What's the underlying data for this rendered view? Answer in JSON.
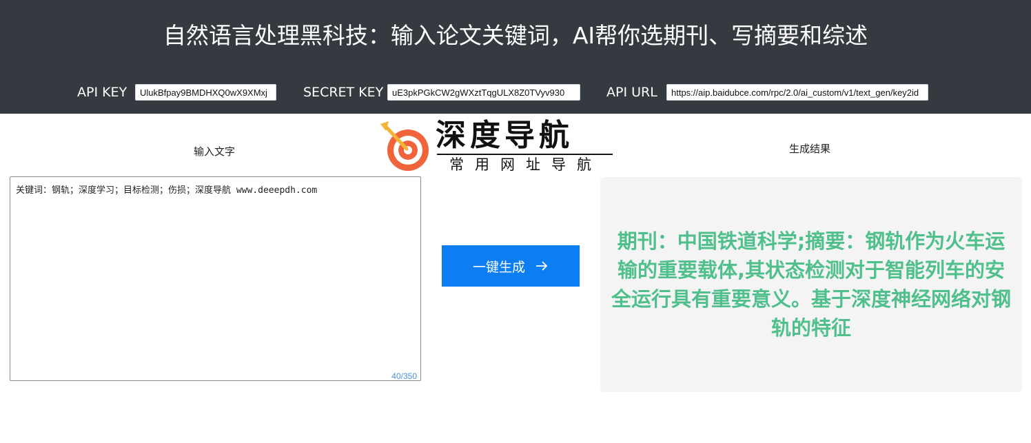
{
  "header": {
    "title": "自然语言处理黑科技：输入论文关键词，AI帮你选期刊、写摘要和综述",
    "api_key": {
      "label": "API KEY",
      "value": "UlukBfpay9BMDHXQ0wX9XMxj"
    },
    "secret_key": {
      "label": "SECRET KEY",
      "value": "uE3pkPGkCW2gWXztTqgULX8Z0TVyv930"
    },
    "api_url": {
      "label": "API URL",
      "value": "https://aip.baidubce.com/rpc/2.0/ai_custom/v1/text_gen/key2id"
    }
  },
  "logo": {
    "name": "深度导航",
    "tagline": "常用网址导航"
  },
  "input": {
    "label": "输入文字",
    "value": "关键词：钢轨；深度学习；目标检测；伤损；深度导航 www.deeepdh.com",
    "char_count": "40/350"
  },
  "action": {
    "generate_label": "一键生成"
  },
  "output": {
    "label": "生成结果",
    "text": "期刊：中国铁道科学;摘要：钢轨作为火车运输的重要载体,其状态检测对于智能列车的安全运行具有重要意义。基于深度神经网络对钢轨的特征"
  },
  "colors": {
    "header_bg": "#343a40",
    "button_bg": "#0d7df4",
    "result_text": "#4fbf8c",
    "result_bg": "#f4f4f4",
    "logo_target_outer": "#f0643c",
    "logo_arrow": "#f5b335"
  },
  "icons": {
    "logo": "target-arrow-icon",
    "button": "arrow-right-icon"
  }
}
